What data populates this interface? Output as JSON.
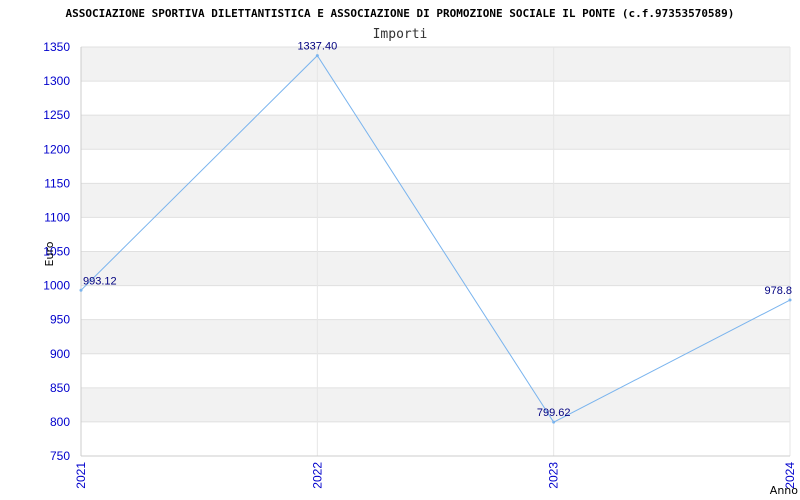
{
  "chart_data": {
    "type": "line",
    "title": "ASSOCIAZIONE SPORTIVA DILETTANTISTICA E ASSOCIAZIONE DI PROMOZIONE SOCIALE IL PONTE (c.f.97353570589)",
    "subtitle": "Importi",
    "xlabel": "Anno",
    "ylabel": "Euro",
    "categories": [
      "2021",
      "2022",
      "2023",
      "2024"
    ],
    "series": [
      {
        "values": [
          993.12,
          1337.4,
          799.62,
          978.8
        ],
        "labels": [
          "993.12",
          "1337.40",
          "799.62",
          "978.8"
        ]
      }
    ],
    "ylim": [
      750,
      1350
    ],
    "yticks": [
      "750",
      "800",
      "850",
      "900",
      "950",
      "1000",
      "1050",
      "1100",
      "1150",
      "1200",
      "1250",
      "1300",
      "1350"
    ],
    "grid": true,
    "colors": {
      "line": "#7ab4ee",
      "band": "#f2f2f2",
      "tick_text": "#0000cc",
      "data_label": "#000080"
    }
  }
}
